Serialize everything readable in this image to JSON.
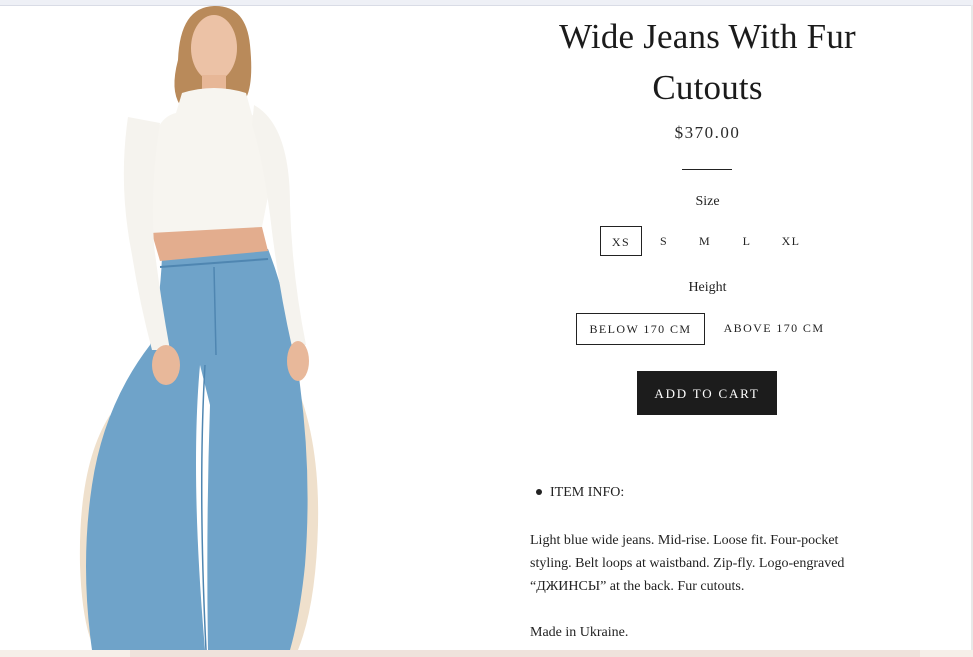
{
  "product": {
    "title_line1": "Wide Jeans With Fur",
    "title_line2": "Cutouts",
    "price": "$370.00",
    "image_alt": "Model wearing light blue wide jeans with fur cutouts and a cropped white top"
  },
  "size": {
    "label": "Size",
    "options": [
      "XS",
      "S",
      "M",
      "L",
      "XL"
    ],
    "selected": "XS"
  },
  "height": {
    "label": "Height",
    "options": [
      "BELOW 170 CM",
      "ABOVE 170 CM"
    ],
    "selected": "BELOW 170 CM"
  },
  "cart": {
    "label": "ADD TO CART"
  },
  "details": {
    "bullet": "ITEM INFO:",
    "description": "Light blue wide jeans. Mid-rise. Loose fit. Four-pocket styling. Belt loops at waistband. Zip-fly. Logo-engraved “ДЖИНСЫ” at the back. Fur cutouts.",
    "made_in": "Made in Ukraine."
  },
  "colors": {
    "denim": "#6fa3c9",
    "denim_dark": "#4f86b1",
    "fur": "#efe0cc",
    "top": "#f7f5f0",
    "skin": "#e8b89a",
    "hair": "#b98a5a",
    "button": "#1c1c1c"
  }
}
